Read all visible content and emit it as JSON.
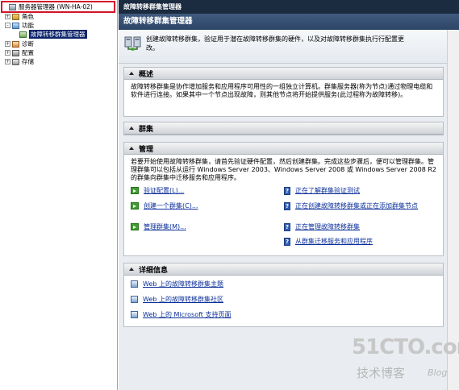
{
  "tree": {
    "items": [
      {
        "label": "服务器管理器 (WN-HA-02)",
        "expander": "-",
        "icon": "server-icon"
      },
      {
        "label": "角色",
        "expander": "+",
        "icon": "roles-icon"
      },
      {
        "label": "功能",
        "expander": "-",
        "icon": "features-icon"
      },
      {
        "label": "故障转移群集管理器",
        "expander": "",
        "icon": "cluster-manager-icon",
        "selected": true
      },
      {
        "label": "诊断",
        "expander": "+",
        "icon": "diagnostics-icon"
      },
      {
        "label": "配置",
        "expander": "+",
        "icon": "configuration-icon"
      },
      {
        "label": "存储",
        "expander": "+",
        "icon": "storage-icon"
      }
    ]
  },
  "content": {
    "header": "故障转移群集管理器",
    "title": "故障转移群集管理器",
    "intro": "创建故障转移群集，验证用于潜在故障转移群集的硬件，以及对故障转移群集执行行配置更改。",
    "overview": {
      "title": "概述",
      "text": "故障转移群集是协作增加服务和应用程序可用性的一组独立计算机。群集服务器(称为节点)通过物理电缆和软件进行连接。如果其中一个节点出现故障，则其他节点将开始提供服务(此过程称为故障转移)。"
    },
    "clusters": {
      "title": "群集"
    },
    "manage": {
      "title": "管理",
      "text": "若要开始使用故障转移群集，请首先验证硬件配置，然后创建群集。完成这些步骤后，便可以管理群集。管理群集可以包括从运行 Windows Server 2003、Windows Server 2008 或 Windows Server 2008 R2 的群集向群集中迁移服务和应用程序。",
      "actions_left": [
        "验证配置(L)...",
        "创建一个群集(C)...",
        "管理群集(M)..."
      ],
      "actions_right": [
        "正在了解群集验证测试",
        "正在创建故障转移群集或正在添加群集节点",
        "正在管理故障转移群集",
        "从群集迁移服务和应用程序"
      ]
    },
    "details": {
      "title": "详细信息",
      "links": [
        "Web 上的故障转移群集主题",
        "Web 上的故障转移群集社区",
        "Web 上的 Microsoft 支持页面"
      ]
    }
  },
  "watermark": {
    "main": "51CTO.com",
    "sub": "技术博客",
    "blog": "Blog"
  }
}
